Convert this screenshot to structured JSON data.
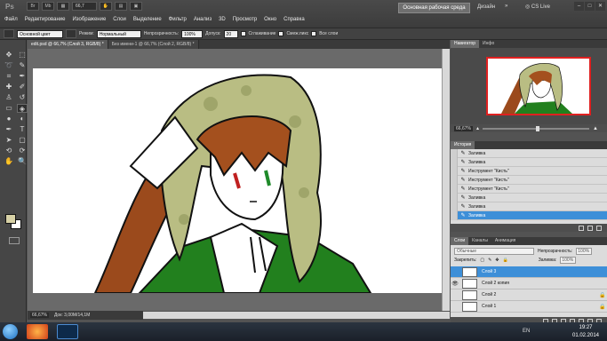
{
  "app": {
    "logo": "Ps",
    "workspace_button": "Основная рабочая среда",
    "design_label": "Дизайн",
    "cs_live": "CS Live",
    "zoom_value": "66,7"
  },
  "menu": [
    "Файл",
    "Редактирование",
    "Изображение",
    "Слои",
    "Выделение",
    "Фильтр",
    "Анализ",
    "3D",
    "Просмотр",
    "Окно",
    "Справка"
  ],
  "options": {
    "preset": "Основной цвет",
    "mode_label": "Режим:",
    "mode_value": "Нормальный",
    "opacity_label": "Непрозрачность:",
    "opacity_value": "100%",
    "tolerance_label": "Допуск:",
    "tolerance_value": "20",
    "antialias_label": "Сглаживание",
    "contiguous_label": "Смеж.пикс",
    "all_layers_label": "Все слои"
  },
  "doc_tabs": [
    "edit.psd @ 66,7% (Слой 3, RGB/8) *",
    "Без имени-1 @ 66,7% (Слой 2, RGB/8) *"
  ],
  "status": {
    "zoom": "66,67%",
    "doc": "Док: 3,00M/14,1M"
  },
  "navigator": {
    "tabs": [
      "Навигатор",
      "Инфо"
    ],
    "zoom": "66,67%"
  },
  "history": {
    "tab": "История",
    "items": [
      "Заливка",
      "Заливка",
      "Инструмент \"Кисть\"",
      "Инструмент \"Кисть\"",
      "Инструмент \"Кисть\"",
      "Заливка",
      "Заливка",
      "Заливка"
    ],
    "selected_index": 7
  },
  "layers": {
    "tabs": [
      "Слои",
      "Каналы",
      "Анимация"
    ],
    "blend_mode": "Обычные",
    "opacity_label": "Непрозрачность:",
    "opacity_value": "100%",
    "lock_label": "Закрепить:",
    "fill_label": "Заливка:",
    "fill_value": "100%",
    "items": [
      {
        "name": "Слой 3",
        "selected": true,
        "visible": false,
        "locked": false
      },
      {
        "name": "Слой 2 копия",
        "selected": false,
        "visible": true,
        "locked": false
      },
      {
        "name": "Слой 2",
        "selected": false,
        "visible": false,
        "locked": true
      },
      {
        "name": "Слой 1",
        "selected": false,
        "visible": false,
        "locked": true
      }
    ]
  },
  "taskbar": {
    "lang": "EN",
    "time": "19:27",
    "date": "01.02.2014"
  },
  "colors": {
    "foreground": "#d7d1a6",
    "background": "#ffffff",
    "selection": "#3d8fd8"
  }
}
